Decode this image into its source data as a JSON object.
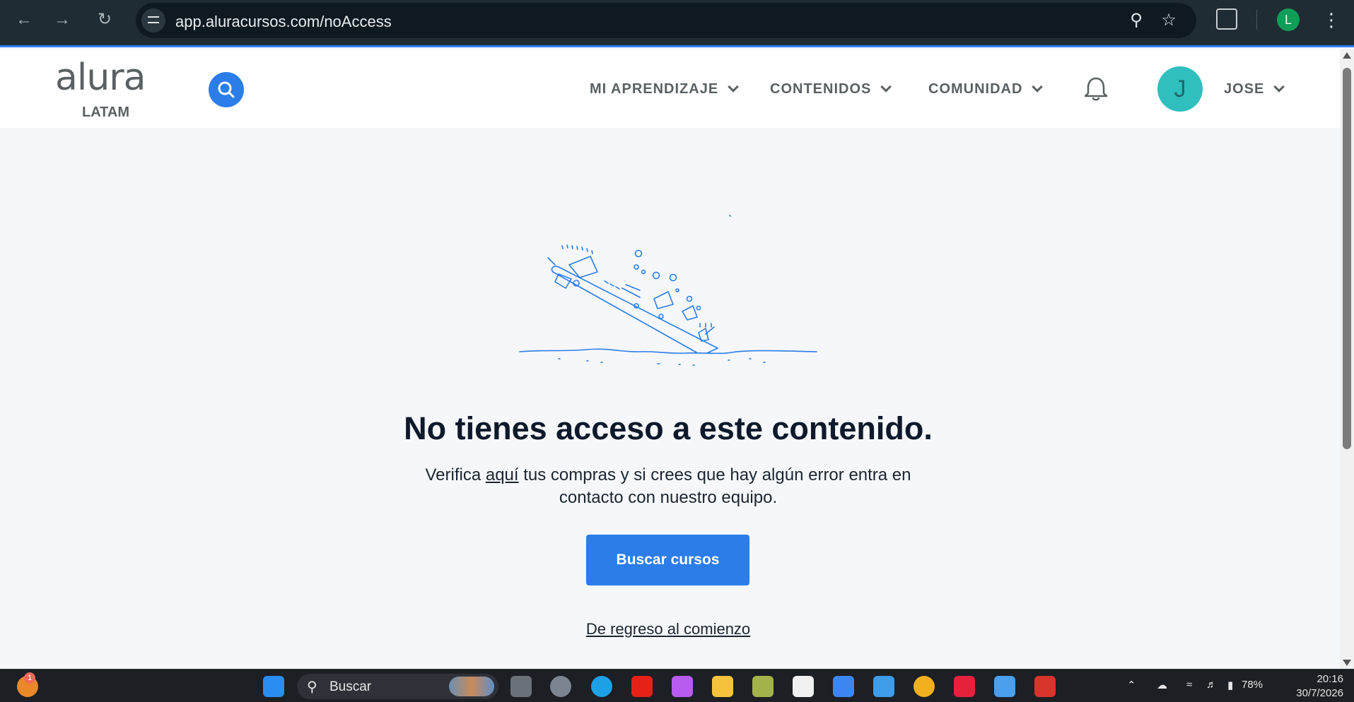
{
  "browser": {
    "url": "app.aluracursos.com/noAccess",
    "profile_initial": "L"
  },
  "header": {
    "logo_brand": "alura",
    "logo_region": "LATAM",
    "nav": [
      {
        "label": "MI APRENDIZAJE"
      },
      {
        "label": "CONTENIDOS"
      },
      {
        "label": "COMUNIDAD"
      }
    ],
    "user": {
      "initial": "J",
      "name": "JOSE"
    }
  },
  "main": {
    "title": "No tienes acceso a este contenido.",
    "description_before": "Verifica ",
    "description_link": "aquí",
    "description_after": " tus compras y si crees que hay algún error entra en contacto con nuestro equipo.",
    "cta_label": "Buscar cursos",
    "back_link": "De regreso al comienzo"
  },
  "taskbar": {
    "search_placeholder": "Buscar",
    "notification_count": "1",
    "battery": "78%",
    "time": "20:16",
    "date": "30/7/2026"
  },
  "colors": {
    "accent": "#2b7de9",
    "avatar": "#2fbfbf",
    "heading": "#0e1a2b",
    "background": "#f5f7fa"
  }
}
